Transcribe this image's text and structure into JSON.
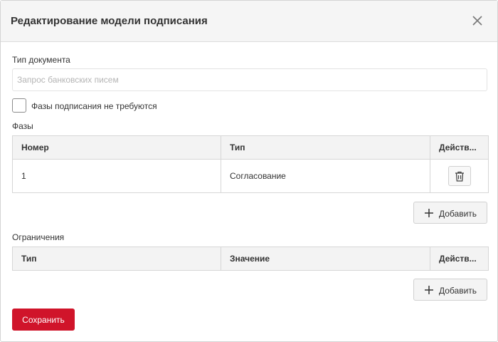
{
  "dialog": {
    "title": "Редактирование модели подписания",
    "close_icon": "close-icon"
  },
  "document_type": {
    "label": "Тип документа",
    "placeholder": "Запрос банковских писем",
    "value": ""
  },
  "no_phases_checkbox": {
    "label": "Фазы подписания не требуются",
    "checked": false
  },
  "phases": {
    "label": "Фазы",
    "columns": [
      "Номер",
      "Тип",
      "Действ..."
    ],
    "rows": [
      {
        "number": "1",
        "type": "Согласование",
        "action_icon": "trash-icon"
      }
    ],
    "add_label": "Добавить"
  },
  "restrictions": {
    "label": "Ограничения",
    "columns": [
      "Тип",
      "Значение",
      "Действ..."
    ],
    "rows": [],
    "add_label": "Добавить"
  },
  "save_label": "Сохранить",
  "colors": {
    "primary": "#d0142a",
    "header_bg": "#f5f5f5",
    "table_header_bg": "#f3f3f3",
    "border": "#d6d6d6"
  }
}
